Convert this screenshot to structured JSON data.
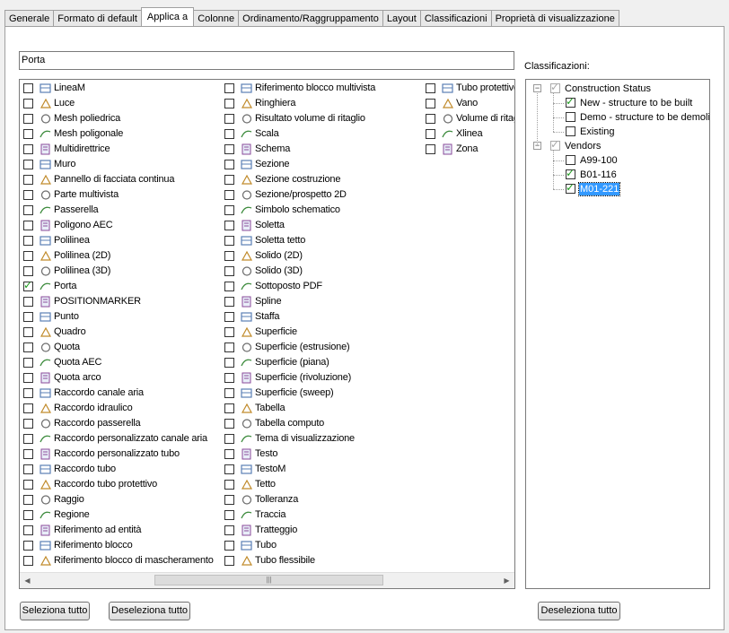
{
  "tabs": [
    "Generale",
    "Formato di default",
    "Applica a",
    "Colonne",
    "Ordinamento/Raggruppamento",
    "Layout",
    "Classificazioni",
    "Proprietà di visualizzazione"
  ],
  "active_tab": "Applica a",
  "filter_value": "Porta",
  "objects_col1": [
    {
      "label": "LineaM",
      "icon": "multiline-icon",
      "checked": false
    },
    {
      "label": "Luce",
      "icon": "light-icon",
      "checked": false
    },
    {
      "label": "Mesh poliedrica",
      "icon": "polyface-mesh-icon",
      "checked": false
    },
    {
      "label": "Mesh poligonale",
      "icon": "polygon-mesh-icon",
      "checked": false
    },
    {
      "label": "Multidirettrice",
      "icon": "multileader-icon",
      "checked": false
    },
    {
      "label": "Muro",
      "icon": "wall-icon",
      "checked": false
    },
    {
      "label": "Pannello di facciata continua",
      "icon": "curtain-wall-panel-icon",
      "checked": false
    },
    {
      "label": "Parte multivista",
      "icon": "multiview-part-icon",
      "checked": false
    },
    {
      "label": "Passerella",
      "icon": "cable-tray-icon",
      "checked": false
    },
    {
      "label": "Poligono AEC",
      "icon": "aec-polygon-icon",
      "checked": false
    },
    {
      "label": "Polilinea",
      "icon": "polyline-icon",
      "checked": false
    },
    {
      "label": "Polilinea (2D)",
      "icon": "polyline-2d-icon",
      "checked": false
    },
    {
      "label": "Polilinea (3D)",
      "icon": "polyline-3d-icon",
      "checked": false
    },
    {
      "label": "Porta",
      "icon": "door-icon",
      "checked": true
    },
    {
      "label": "POSITIONMARKER",
      "icon": "position-marker-icon",
      "checked": false
    },
    {
      "label": "Punto",
      "icon": "point-icon",
      "checked": false
    },
    {
      "label": "Quadro",
      "icon": "panel-icon",
      "checked": false
    },
    {
      "label": "Quota",
      "icon": "dimension-icon",
      "checked": false
    },
    {
      "label": "Quota AEC",
      "icon": "aec-dimension-icon",
      "checked": false
    },
    {
      "label": "Quota arco",
      "icon": "arc-dimension-icon",
      "checked": false
    },
    {
      "label": "Raccordo canale aria",
      "icon": "duct-fitting-icon",
      "checked": false
    },
    {
      "label": "Raccordo idraulico",
      "icon": "plumbing-fitting-icon",
      "checked": false
    },
    {
      "label": "Raccordo passerella",
      "icon": "cable-tray-fitting-icon",
      "checked": false
    },
    {
      "label": "Raccordo personalizzato canale aria",
      "icon": "custom-duct-fitting-icon",
      "checked": false
    },
    {
      "label": "Raccordo personalizzato tubo",
      "icon": "custom-pipe-fitting-icon",
      "checked": false
    },
    {
      "label": "Raccordo tubo",
      "icon": "pipe-fitting-icon",
      "checked": false
    },
    {
      "label": "Raccordo tubo protettivo",
      "icon": "conduit-fitting-icon",
      "checked": false
    },
    {
      "label": "Raggio",
      "icon": "ray-icon",
      "checked": false
    },
    {
      "label": "Regione",
      "icon": "region-icon",
      "checked": false
    },
    {
      "label": "Riferimento ad entità",
      "icon": "entity-reference-icon",
      "checked": false
    },
    {
      "label": "Riferimento blocco",
      "icon": "block-reference-icon",
      "checked": false
    },
    {
      "label": "Riferimento blocco di mascheramento",
      "icon": "mask-block-reference-icon",
      "checked": false
    }
  ],
  "objects_col2": [
    {
      "label": "Riferimento blocco multivista",
      "icon": "multiview-block-reference-icon",
      "checked": false
    },
    {
      "label": "Ringhiera",
      "icon": "railing-icon",
      "checked": false
    },
    {
      "label": "Risultato volume di ritaglio",
      "icon": "clip-volume-result-icon",
      "checked": false
    },
    {
      "label": "Scala",
      "icon": "stair-icon",
      "checked": false
    },
    {
      "label": "Schema",
      "icon": "schematic-icon",
      "checked": false
    },
    {
      "label": "Sezione",
      "icon": "section-icon",
      "checked": false
    },
    {
      "label": "Sezione costruzione",
      "icon": "building-section-icon",
      "checked": false
    },
    {
      "label": "Sezione/prospetto 2D",
      "icon": "section-elevation-2d-icon",
      "checked": false
    },
    {
      "label": "Simbolo schematico",
      "icon": "schematic-symbol-icon",
      "checked": false
    },
    {
      "label": "Soletta",
      "icon": "slab-icon",
      "checked": false
    },
    {
      "label": "Soletta tetto",
      "icon": "roof-slab-icon",
      "checked": false
    },
    {
      "label": "Solido (2D)",
      "icon": "solid-2d-icon",
      "checked": false
    },
    {
      "label": "Solido (3D)",
      "icon": "solid-3d-icon",
      "checked": false
    },
    {
      "label": "Sottoposto PDF",
      "icon": "pdf-underlay-icon",
      "checked": false
    },
    {
      "label": "Spline",
      "icon": "spline-icon",
      "checked": false
    },
    {
      "label": "Staffa",
      "icon": "hanger-icon",
      "checked": false
    },
    {
      "label": "Superficie",
      "icon": "surface-icon",
      "checked": false
    },
    {
      "label": "Superficie (estrusione)",
      "icon": "extruded-surface-icon",
      "checked": false
    },
    {
      "label": "Superficie (piana)",
      "icon": "planar-surface-icon",
      "checked": false
    },
    {
      "label": "Superficie (rivoluzione)",
      "icon": "revolved-surface-icon",
      "checked": false
    },
    {
      "label": "Superficie (sweep)",
      "icon": "swept-surface-icon",
      "checked": false
    },
    {
      "label": "Tabella",
      "icon": "table-icon",
      "checked": false
    },
    {
      "label": "Tabella computo",
      "icon": "schedule-table-icon",
      "checked": false
    },
    {
      "label": "Tema di visualizzazione",
      "icon": "display-theme-icon",
      "checked": false
    },
    {
      "label": "Testo",
      "icon": "text-icon",
      "checked": false
    },
    {
      "label": "TestoM",
      "icon": "mtext-icon",
      "checked": false
    },
    {
      "label": "Tetto",
      "icon": "roof-icon",
      "checked": false
    },
    {
      "label": "Tolleranza",
      "icon": "tolerance-icon",
      "checked": false
    },
    {
      "label": "Traccia",
      "icon": "trace-icon",
      "checked": false
    },
    {
      "label": "Tratteggio",
      "icon": "hatch-icon",
      "checked": false
    },
    {
      "label": "Tubo",
      "icon": "pipe-icon",
      "checked": false
    },
    {
      "label": "Tubo flessibile",
      "icon": "flex-pipe-icon",
      "checked": false
    }
  ],
  "objects_col3": [
    {
      "label": "Tubo protettivo",
      "icon": "conduit-icon",
      "checked": false
    },
    {
      "label": "Vano",
      "icon": "opening-icon",
      "checked": false
    },
    {
      "label": "Volume di ritaglio",
      "icon": "clip-volume-icon",
      "checked": false
    },
    {
      "label": "Xlinea",
      "icon": "xline-icon",
      "checked": false
    },
    {
      "label": "Zona",
      "icon": "zone-icon",
      "checked": false
    }
  ],
  "classifications_label": "Classificazioni:",
  "tree": [
    {
      "label": "Construction Status",
      "level": 0,
      "checked": true,
      "gray": true,
      "expanded": true
    },
    {
      "label": "New - structure to be built",
      "level": 1,
      "checked": true,
      "gray": false
    },
    {
      "label": "Demo - structure to be demolished",
      "level": 1,
      "checked": false,
      "gray": false
    },
    {
      "label": "Existing",
      "level": 1,
      "checked": false,
      "gray": false
    },
    {
      "label": "Vendors",
      "level": 0,
      "checked": true,
      "gray": true,
      "expanded": true
    },
    {
      "label": "A99-100",
      "level": 1,
      "checked": false,
      "gray": false
    },
    {
      "label": "B01-116",
      "level": 1,
      "checked": true,
      "gray": false
    },
    {
      "label": "M01-221",
      "level": 1,
      "checked": true,
      "gray": false,
      "selected": true
    }
  ],
  "buttons": {
    "select_all": "Seleziona tutto",
    "deselect_all": "Deseleziona tutto",
    "deselect_all_tree": "Deseleziona tutto"
  },
  "colors": {
    "check": "#1d9a1d",
    "selection": "#3399ff"
  }
}
